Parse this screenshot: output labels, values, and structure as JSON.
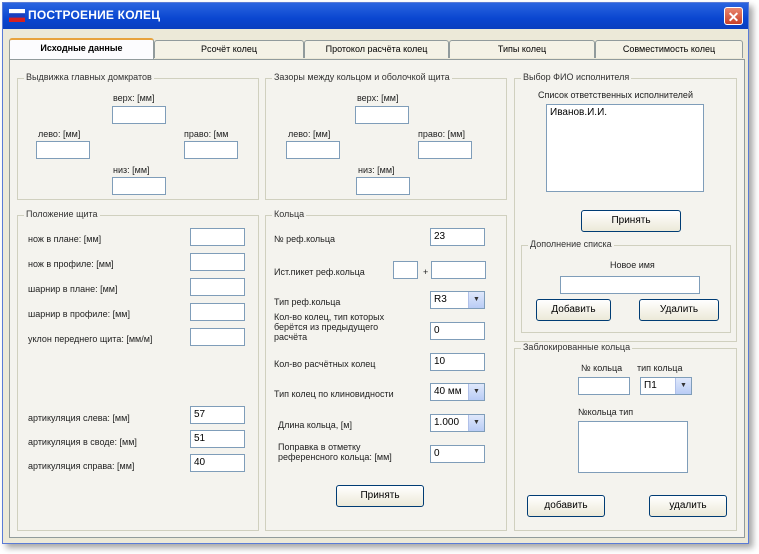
{
  "window": {
    "title": "ПОСТРОЕНИЕ КОЛЕЦ",
    "close_glyph": "✕"
  },
  "colors": {
    "titlebar": "#0a46d0",
    "active_tab_accent": "#e8a33d",
    "close_button": "#c8412a"
  },
  "tabs": [
    {
      "label": "Исходные данные",
      "active": true
    },
    {
      "label": "Рсочёт колец",
      "active": false
    },
    {
      "label": "Протокол расчёта колец",
      "active": false
    },
    {
      "label": "Типы колец",
      "active": false
    },
    {
      "label": "Совместимость колец",
      "active": false
    }
  ],
  "group_jacks": {
    "title": "Выдвижка главных домкратов",
    "top_label": "верх: [мм]",
    "top_value": "",
    "left_label": "лево: [мм]",
    "left_value": "",
    "right_label": "право: [мм",
    "right_value": "",
    "bottom_label": "низ: [мм]",
    "bottom_value": ""
  },
  "group_gaps": {
    "title": "Зазоры между кольцом и оболочкой щита",
    "top_label": "верх: [мм]",
    "top_value": "",
    "left_label": "лево: [мм]",
    "left_value": "",
    "right_label": "право: [мм]",
    "right_value": "",
    "bottom_label": "низ: [мм]",
    "bottom_value": ""
  },
  "group_shield": {
    "title": "Положение щита",
    "rows": [
      {
        "label": "нож в плане: [мм]",
        "value": ""
      },
      {
        "label": "нож в профиле: [мм]",
        "value": ""
      },
      {
        "label": "шарнир в плане: [мм]",
        "value": ""
      },
      {
        "label": "шарнир в профиле: [мм]",
        "value": ""
      },
      {
        "label": "уклон переднего щита: [мм/м]",
        "value": ""
      }
    ],
    "art_rows": [
      {
        "label": "артикуляция слева: [мм]",
        "value": "57"
      },
      {
        "label": "артикуляция в своде: [мм]",
        "value": "51"
      },
      {
        "label": "артикуляция справа: [мм]",
        "value": "40"
      }
    ]
  },
  "group_rings": {
    "title": "Кольца",
    "ref_num_label": "№ реф.кольца",
    "ref_num_value": "23",
    "picket_label": "Ист.пикет реф.кольца",
    "picket_a": "",
    "picket_sep": "+",
    "picket_b": "",
    "ref_type_label": "Тип реф.кольца",
    "ref_type_value": "R3",
    "prev_count_label": "Кол-во колец, тип которых берётся из предыдущего расчёта",
    "prev_count_value": "0",
    "calc_count_label": "Кол-во расчётных колец",
    "calc_count_value": "10",
    "taper_label": "Тип колец по клиновидности",
    "taper_value": "40 мм",
    "length_label": "Длина кольца, [м]",
    "length_value": "1.000",
    "correction_label": "Поправка в отметку референсного кольца: [мм]",
    "correction_value": "0",
    "accept_button": "Принять"
  },
  "group_fio": {
    "title": "Выбор ФИО исполнителя",
    "list_label": "Список ответственных исполнителей",
    "list_items": [
      "Иванов.И.И."
    ],
    "accept_button": "Принять",
    "add_group_title": "Дополнение списка",
    "new_name_label": "Новое имя",
    "new_name_value": "",
    "add_button": "Добавить",
    "delete_button": "Удалить"
  },
  "group_blocked": {
    "title": "Заблокированные кольца",
    "num_label": "№ кольца",
    "num_value": "",
    "type_label": "тип кольца",
    "type_value": "П1",
    "list_header": "№кольца    тип",
    "add_button": "добавить",
    "delete_button": "удалить"
  }
}
